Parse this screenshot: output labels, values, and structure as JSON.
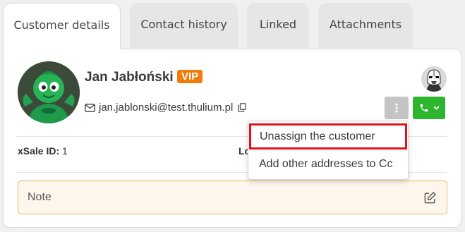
{
  "tabs": [
    {
      "label": "Customer details",
      "active": true
    },
    {
      "label": "Contact history",
      "active": false
    },
    {
      "label": "Linked",
      "active": false
    },
    {
      "label": "Attachments",
      "active": false
    }
  ],
  "customer": {
    "name": "Jan Jabłoński",
    "badge": "VIP",
    "email": "jan.jablonski@test.thulium.pl",
    "avatar_icon": "green-superhero-avatar",
    "email_icon": "envelope-icon",
    "copy_icon": "copy-icon"
  },
  "agent": {
    "avatar_icon": "stormtrooper-avatar"
  },
  "actions": {
    "more_icon": "vertical-dots-icon",
    "call_icon": "phone-icon",
    "call_dropdown_icon": "chevron-down-icon"
  },
  "fields": {
    "xsale_label": "xSale ID:",
    "xsale_value": "1",
    "second_label": "Lo"
  },
  "note": {
    "label": "Note",
    "edit_icon": "edit-icon"
  },
  "menu": {
    "items": [
      {
        "label": "Unassign the customer",
        "highlighted": true
      },
      {
        "label": "Add other addresses to Cc",
        "highlighted": false
      }
    ]
  },
  "colors": {
    "vip": "#f07c0c",
    "call_button": "#2db52d",
    "more_button": "#c4c4c4",
    "note_border": "#f2b25c",
    "note_background": "#fdf6ec",
    "highlight": "#e0121b"
  }
}
